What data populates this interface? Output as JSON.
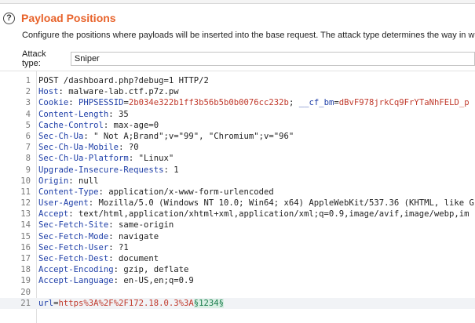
{
  "header": {
    "help_icon": "?",
    "title": "Payload Positions",
    "description": "Configure the positions where payloads will be inserted into the base request. The attack type determines the way in which p"
  },
  "attack": {
    "label": "Attack type:",
    "value": "Sniper"
  },
  "request": {
    "line1": "POST /dashboard.php?debug=1 HTTP/2",
    "host_key": "Host",
    "host_val": ": malware-lab.ctf.p7z.pw",
    "cookie_key": "Cookie",
    "cookie_sep1": ": ",
    "c1_key": "PHPSESSID",
    "c1_eq": "=",
    "c1_val": "2b034e322b1ff3b56b5b0b0076cc232b",
    "cookie_sep2": "; ",
    "c2_key": "__cf_bm",
    "c2_eq": "=",
    "c2_val": "dBvF978jrkCq9FrYTaNhFELD_p",
    "cl_key": "Content-Length",
    "cl_val": ": 35",
    "cc_key": "Cache-Control",
    "cc_val": ": max-age=0",
    "ua_key": "Sec-Ch-Ua",
    "ua_val": ": \" Not A;Brand\";v=\"99\", \"Chromium\";v=\"96\"",
    "uam_key": "Sec-Ch-Ua-Mobile",
    "uam_val": ": ?0",
    "uap_key": "Sec-Ch-Ua-Platform",
    "uap_val": ": \"Linux\"",
    "uir_key": "Upgrade-Insecure-Requests",
    "uir_val": ": 1",
    "origin_key": "Origin",
    "origin_val": ": null",
    "ct_key": "Content-Type",
    "ct_val": ": application/x-www-form-urlencoded",
    "useragent_key": "User-Agent",
    "useragent_val": ": Mozilla/5.0 (Windows NT 10.0; Win64; x64) AppleWebKit/537.36 (KHTML, like G",
    "accept_key": "Accept",
    "accept_val": ": text/html,application/xhtml+xml,application/xml;q=0.9,image/avif,image/webp,im",
    "sfs_key": "Sec-Fetch-Site",
    "sfs_val": ": same-origin",
    "sfm_key": "Sec-Fetch-Mode",
    "sfm_val": ": navigate",
    "sfu_key": "Sec-Fetch-User",
    "sfu_val": ": ?1",
    "sfd_key": "Sec-Fetch-Dest",
    "sfd_val": ": document",
    "ae_key": "Accept-Encoding",
    "ae_val": ": gzip, deflate",
    "al_key": "Accept-Language",
    "al_val": ": en-US,en;q=0.9",
    "blank": "",
    "body_key": "url",
    "body_eq": "=",
    "body_val": "https%3A%2F%2F172.18.0.3%3A",
    "payload_marker": "§1234§"
  },
  "line_numbers": [
    "1",
    "2",
    "3",
    "4",
    "5",
    "6",
    "7",
    "8",
    "9",
    "10",
    "11",
    "12",
    "13",
    "14",
    "15",
    "16",
    "17",
    "18",
    "19",
    "20",
    "21"
  ]
}
